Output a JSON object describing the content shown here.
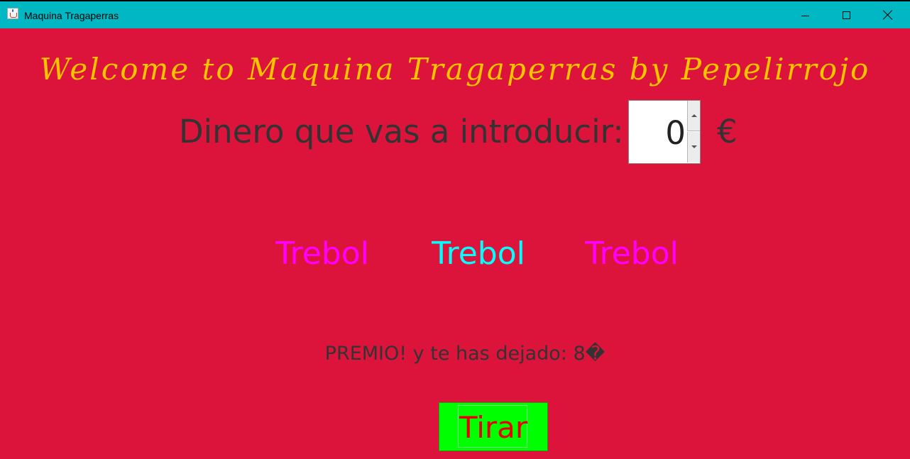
{
  "window": {
    "title": "Maquina Tragaperras",
    "background": "#dc143c",
    "titlebar_color": "#00b7c3",
    "controls": [
      "minimize-icon",
      "maximize-icon",
      "close-icon"
    ]
  },
  "header": {
    "welcome": "Welcome to Maquina Tragaperras by Pepelirrojo",
    "welcome_color": "#f5c400"
  },
  "bet": {
    "label": "Dinero que vas a introducir:",
    "value": "0",
    "currency": "€"
  },
  "reels": [
    {
      "label": "Trebol",
      "color": "#ff00ff"
    },
    {
      "label": "Trebol",
      "color": "#00ffff"
    },
    {
      "label": "Trebol",
      "color": "#ff00ff"
    }
  ],
  "result": {
    "text": "PREMIO! y te has dejado: 8�"
  },
  "actions": {
    "spin_label": "Tirar",
    "spin_bg": "#00ff00",
    "spin_fg": "#e60000"
  }
}
